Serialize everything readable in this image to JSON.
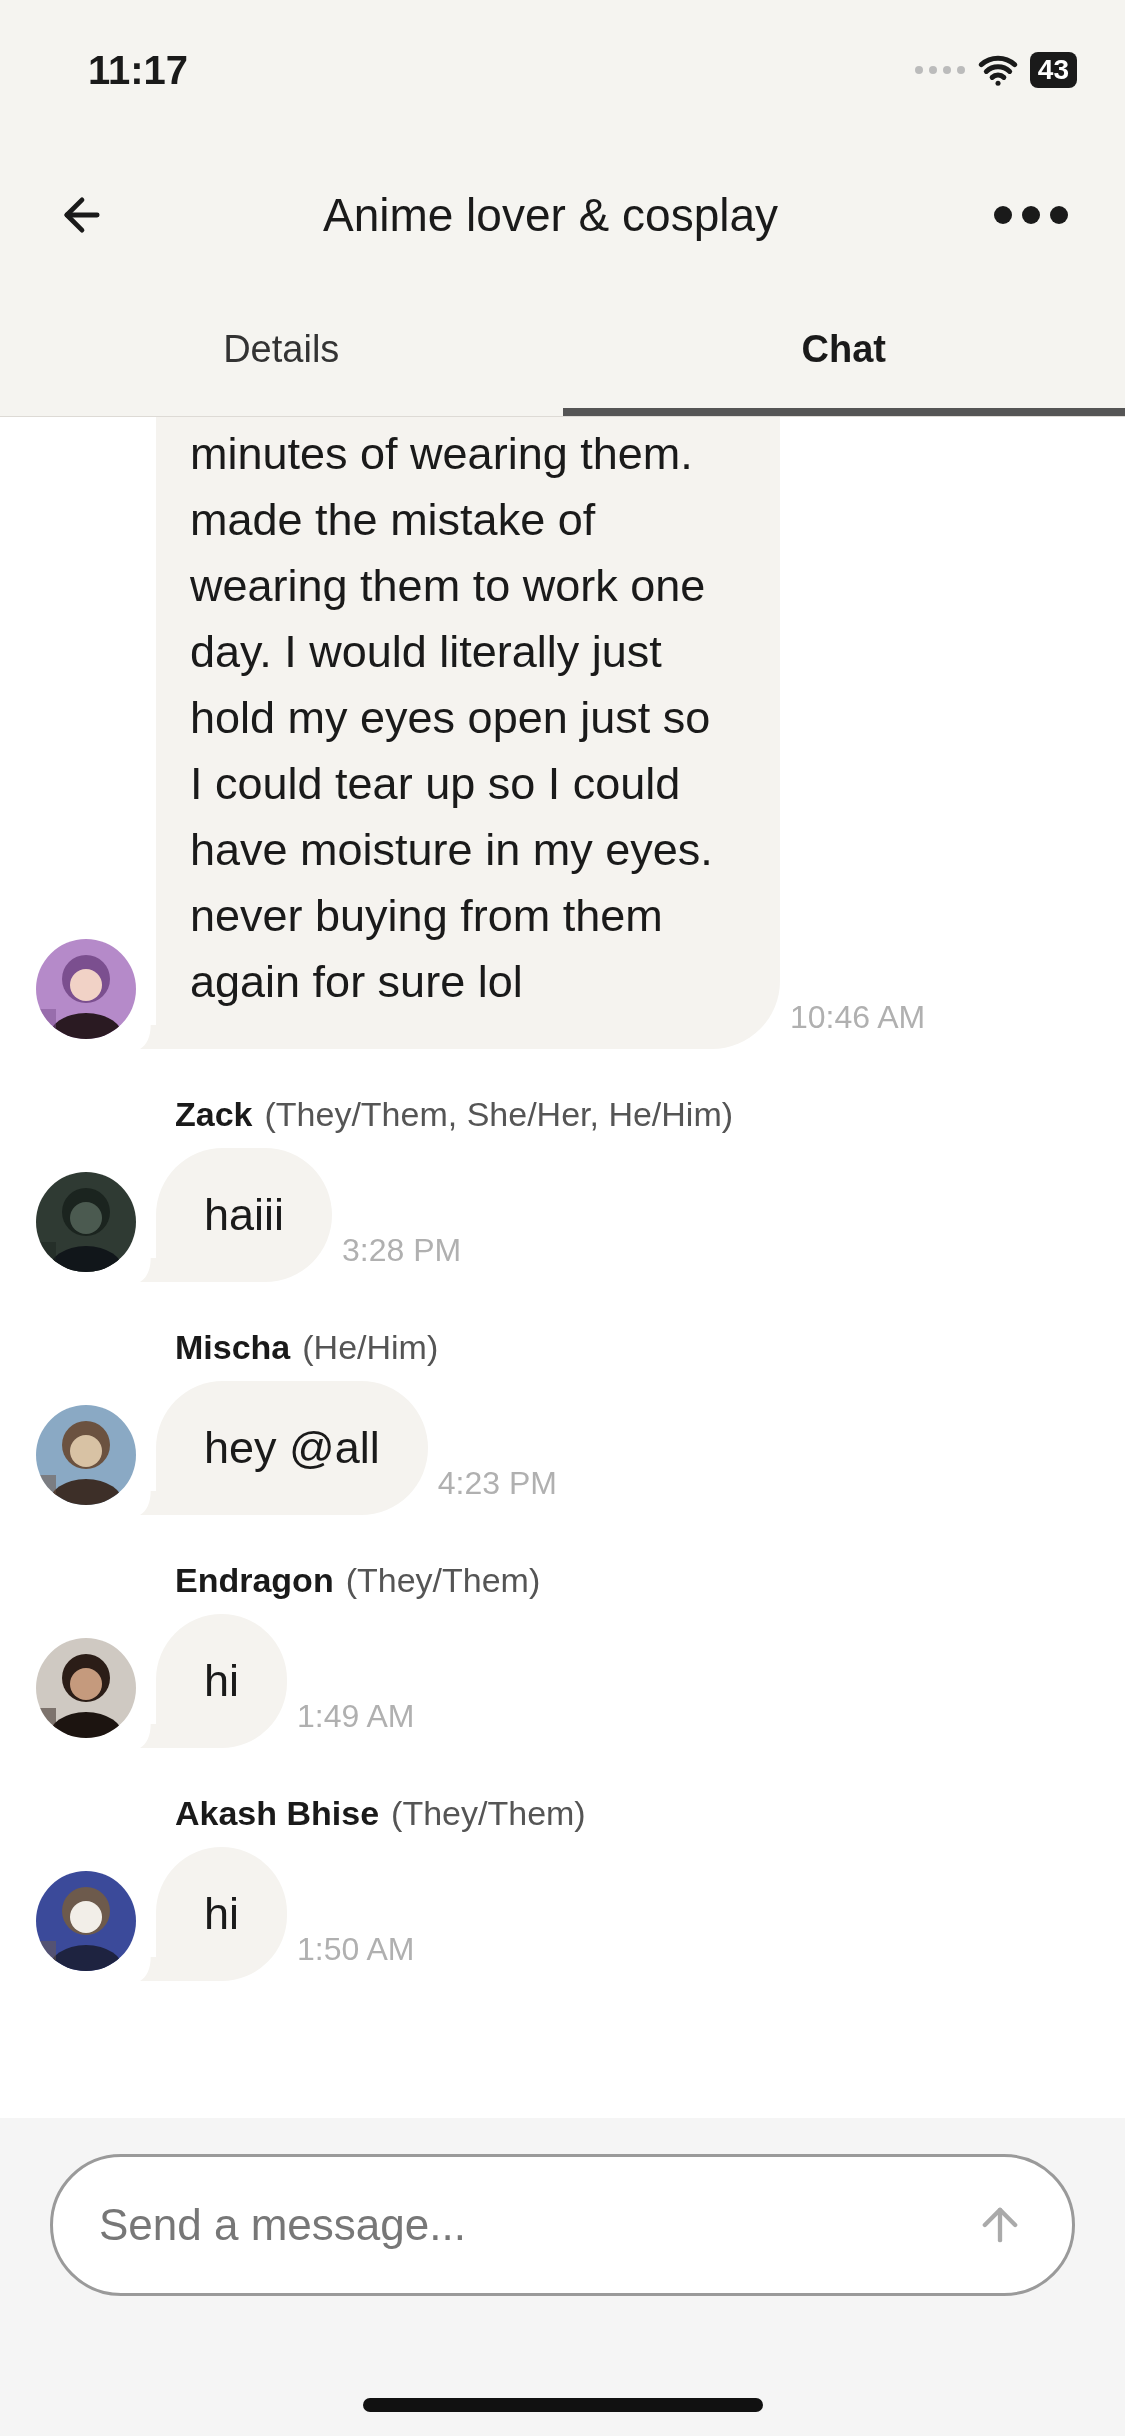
{
  "status_bar": {
    "time": "11:17",
    "battery": "43"
  },
  "header": {
    "title": "Anime lover & cosplay"
  },
  "tabs": [
    {
      "label": "Details",
      "selected": false
    },
    {
      "label": "Chat",
      "selected": true
    }
  ],
  "messages": [
    {
      "text": "minutes of wearing them. made the mistake of wearing them to work one day. I would literally just hold my eyes open just so I could tear up so I could have moisture in my eyes. never buying from them again for sure lol",
      "time": "10:46 AM"
    },
    {
      "author": "Zack",
      "pronouns": "(They/Them, She/Her, He/Him)",
      "text": "haiii",
      "time": "3:28 PM"
    },
    {
      "author": "Mischa",
      "pronouns": "(He/Him)",
      "text": "hey @all",
      "time": "4:23 PM"
    },
    {
      "author": "Endragon",
      "pronouns": "(They/Them)",
      "text": "hi",
      "time": "1:49 AM"
    },
    {
      "author": "Akash Bhise",
      "pronouns": "(They/Them)",
      "text": "hi",
      "time": "1:50 AM"
    }
  ],
  "composer": {
    "placeholder": "Send a message..."
  }
}
